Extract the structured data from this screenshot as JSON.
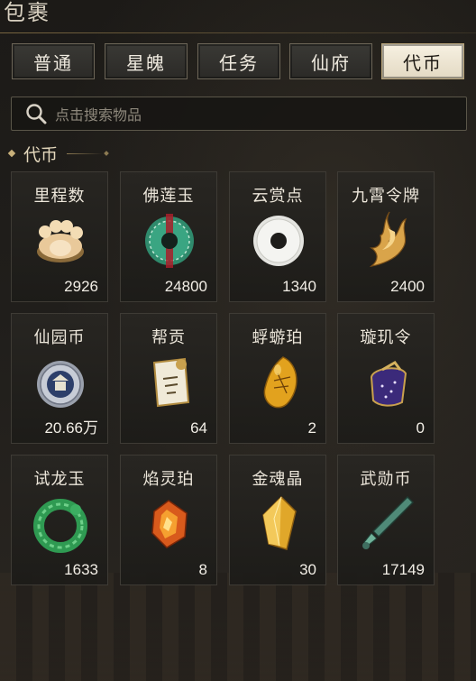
{
  "window": {
    "title": "包裹"
  },
  "tabs": [
    {
      "label": "普通",
      "active": false
    },
    {
      "label": "星魄",
      "active": false
    },
    {
      "label": "任务",
      "active": false
    },
    {
      "label": "仙府",
      "active": false
    },
    {
      "label": "代币",
      "active": true
    }
  ],
  "search": {
    "placeholder": "点击搜索物品",
    "icon": "search-icon"
  },
  "section": {
    "title": "代币"
  },
  "items": [
    {
      "name": "里程数",
      "quantity": "2926",
      "icon": "paw-token-icon"
    },
    {
      "name": "佛莲玉",
      "quantity": "24800",
      "icon": "green-jade-ring-icon"
    },
    {
      "name": "云赏点",
      "quantity": "1340",
      "icon": "white-jade-disc-icon"
    },
    {
      "name": "九霄令牌",
      "quantity": "2400",
      "icon": "golden-flame-token-icon"
    },
    {
      "name": "仙园币",
      "quantity": "20.66万",
      "icon": "garden-coin-icon"
    },
    {
      "name": "帮贡",
      "quantity": "64",
      "icon": "guild-tag-icon"
    },
    {
      "name": "蜉蝣珀",
      "quantity": "2",
      "icon": "amber-insect-icon"
    },
    {
      "name": "璇玑令",
      "quantity": "0",
      "icon": "purple-pouch-icon"
    },
    {
      "name": "试龙玉",
      "quantity": "1633",
      "icon": "dragon-jade-icon"
    },
    {
      "name": "焰灵珀",
      "quantity": "8",
      "icon": "flame-amber-icon"
    },
    {
      "name": "金魂晶",
      "quantity": "30",
      "icon": "gold-crystal-icon"
    },
    {
      "name": "武勋币",
      "quantity": "17149",
      "icon": "blade-coin-icon"
    }
  ]
}
